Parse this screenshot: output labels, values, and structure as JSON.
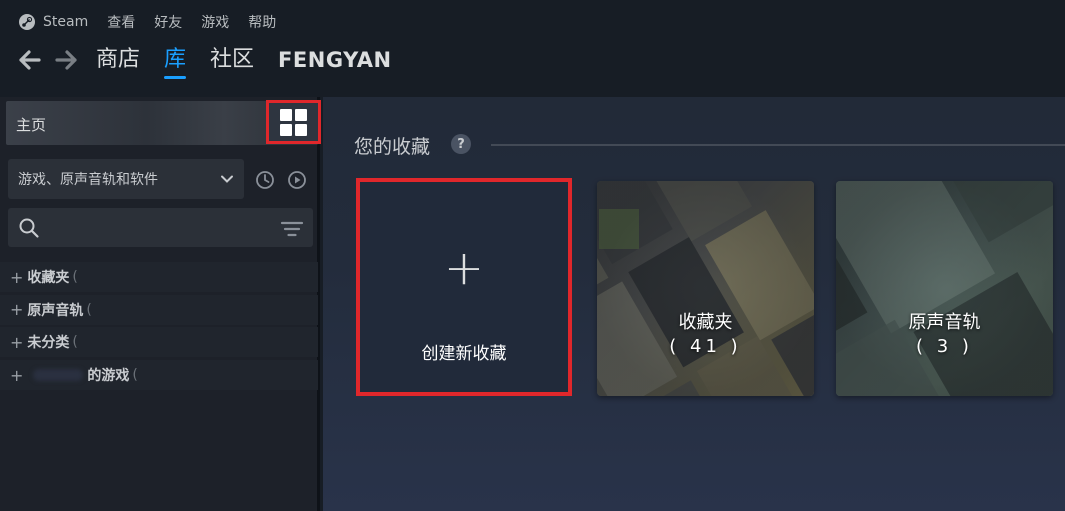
{
  "menubar": {
    "app_name": "Steam",
    "items": [
      "查看",
      "好友",
      "游戏",
      "帮助"
    ]
  },
  "nav": {
    "tabs": [
      "商店",
      "库",
      "社区",
      "FENGYAN"
    ],
    "active_tab": "库"
  },
  "sidebar": {
    "home_label": "主页",
    "filter_label": "游戏、原声音轨和软件",
    "collections": [
      {
        "label": "收藏夹",
        "count_open": "("
      },
      {
        "label": "原声音轨",
        "count_open": "("
      },
      {
        "label": "未分类",
        "count_open": "("
      },
      {
        "label": "的游戏",
        "count_open": "("
      }
    ]
  },
  "main": {
    "section_title": "您的收藏",
    "help_badge": "?",
    "create_plus": "+",
    "create_label": "创建新收藏",
    "cards": [
      {
        "name": "收藏夹",
        "count": "( 41 )"
      },
      {
        "name": "原声音轨",
        "count": "( 3 )"
      }
    ]
  },
  "colors": {
    "accent": "#1a9fff",
    "highlight_box": "#e0272b",
    "background": "#171d25"
  },
  "icons": [
    "steam-logo-icon",
    "back-arrow-icon",
    "forward-arrow-icon",
    "grid-view-icon",
    "chevron-down-icon",
    "recent-clock-icon",
    "play-icon",
    "search-icon",
    "sort-filter-icon",
    "plus-icon",
    "help-icon"
  ]
}
